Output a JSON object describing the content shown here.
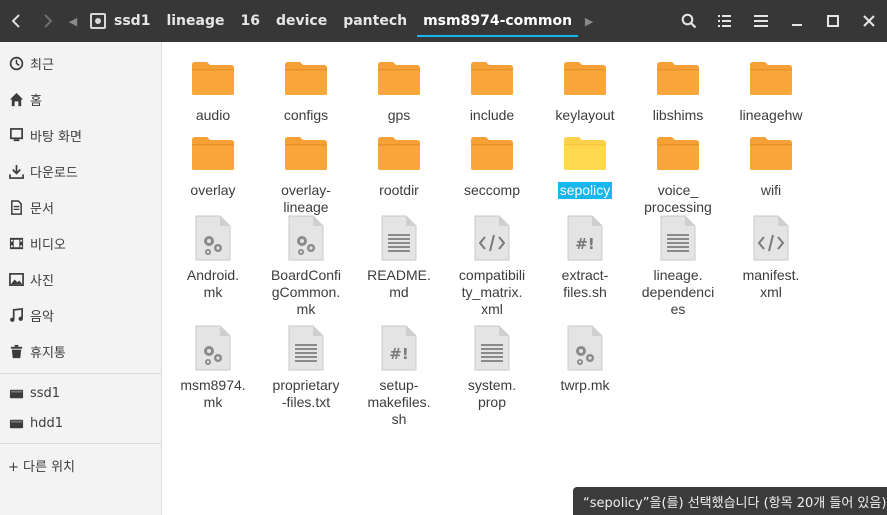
{
  "header": {
    "crumbs": [
      "ssd1",
      "lineage",
      "16",
      "device",
      "pantech",
      "msm8974-common"
    ]
  },
  "sidebar": {
    "items": [
      {
        "label": "최근",
        "icon": "clock-icon"
      },
      {
        "label": "홈",
        "icon": "home-icon"
      },
      {
        "label": "바탕 화면",
        "icon": "desktop-icon"
      },
      {
        "label": "다운로드",
        "icon": "download-icon"
      },
      {
        "label": "문서",
        "icon": "document-icon"
      },
      {
        "label": "비디오",
        "icon": "video-icon"
      },
      {
        "label": "사진",
        "icon": "picture-icon"
      },
      {
        "label": "음악",
        "icon": "music-icon"
      },
      {
        "label": "휴지통",
        "icon": "trash-icon"
      }
    ],
    "devices": [
      {
        "label": "ssd1",
        "icon": "drive-icon"
      },
      {
        "label": "hdd1",
        "icon": "drive-icon"
      }
    ],
    "other": {
      "label": "+ 다른 위치"
    }
  },
  "files": [
    {
      "name": "audio",
      "type": "folder"
    },
    {
      "name": "configs",
      "type": "folder"
    },
    {
      "name": "gps",
      "type": "folder"
    },
    {
      "name": "include",
      "type": "folder"
    },
    {
      "name": "keylayout",
      "type": "folder"
    },
    {
      "name": "libshims",
      "type": "folder"
    },
    {
      "name": "lineagehw",
      "type": "folder"
    },
    {
      "name": "overlay",
      "type": "folder"
    },
    {
      "name": "overlay-lineage",
      "type": "folder"
    },
    {
      "name": "rootdir",
      "type": "folder"
    },
    {
      "name": "seccomp",
      "type": "folder"
    },
    {
      "name": "sepolicy",
      "type": "folder",
      "selected": true
    },
    {
      "name": "voice_ processing",
      "type": "folder"
    },
    {
      "name": "wifi",
      "type": "folder"
    },
    {
      "name": "Android.mk",
      "type": "makefile"
    },
    {
      "name": "BoardConfigCommon.mk",
      "type": "makefile"
    },
    {
      "name": "README.md",
      "type": "text"
    },
    {
      "name": "compatibility_matrix.xml",
      "type": "code"
    },
    {
      "name": "extract-files.sh",
      "type": "script"
    },
    {
      "name": "lineage.dependencies",
      "type": "text"
    },
    {
      "name": "manifest.xml",
      "type": "code"
    },
    {
      "name": "msm8974.mk",
      "type": "makefile"
    },
    {
      "name": "proprietary-files.txt",
      "type": "text"
    },
    {
      "name": "setup-makefiles.sh",
      "type": "script"
    },
    {
      "name": "system.prop",
      "type": "text"
    },
    {
      "name": "twrp.mk",
      "type": "makefile"
    }
  ],
  "labels": {
    "Android.mk": "Android.\nmk",
    "BoardConfigCommon.mk": "BoardConfi\ngCommon.\nmk",
    "README.md": "README.\nmd",
    "compatibility_matrix.xml": "compatibili\nty_matrix.\nxml",
    "extract-files.sh": "extract-\nfiles.sh",
    "lineage.dependencies": "lineage.\ndependenci\nes",
    "manifest.xml": "manifest.\nxml",
    "msm8974.mk": "msm8974.\nmk",
    "proprietary-files.txt": "proprietary\n-files.txt",
    "setup-makefiles.sh": "setup-\nmakefiles.\nsh",
    "system.prop": "system.\nprop",
    "overlay-lineage": "overlay-\nlineage",
    "voice_ processing": "voice_\nprocessing"
  },
  "status": "“sepolicy”을(를) 선택했습니다  (항목 20개 들어 있음)",
  "colors": {
    "folder": "#f7a035",
    "folder_selected": "#fcd24a",
    "accent": "#19b6ee"
  }
}
